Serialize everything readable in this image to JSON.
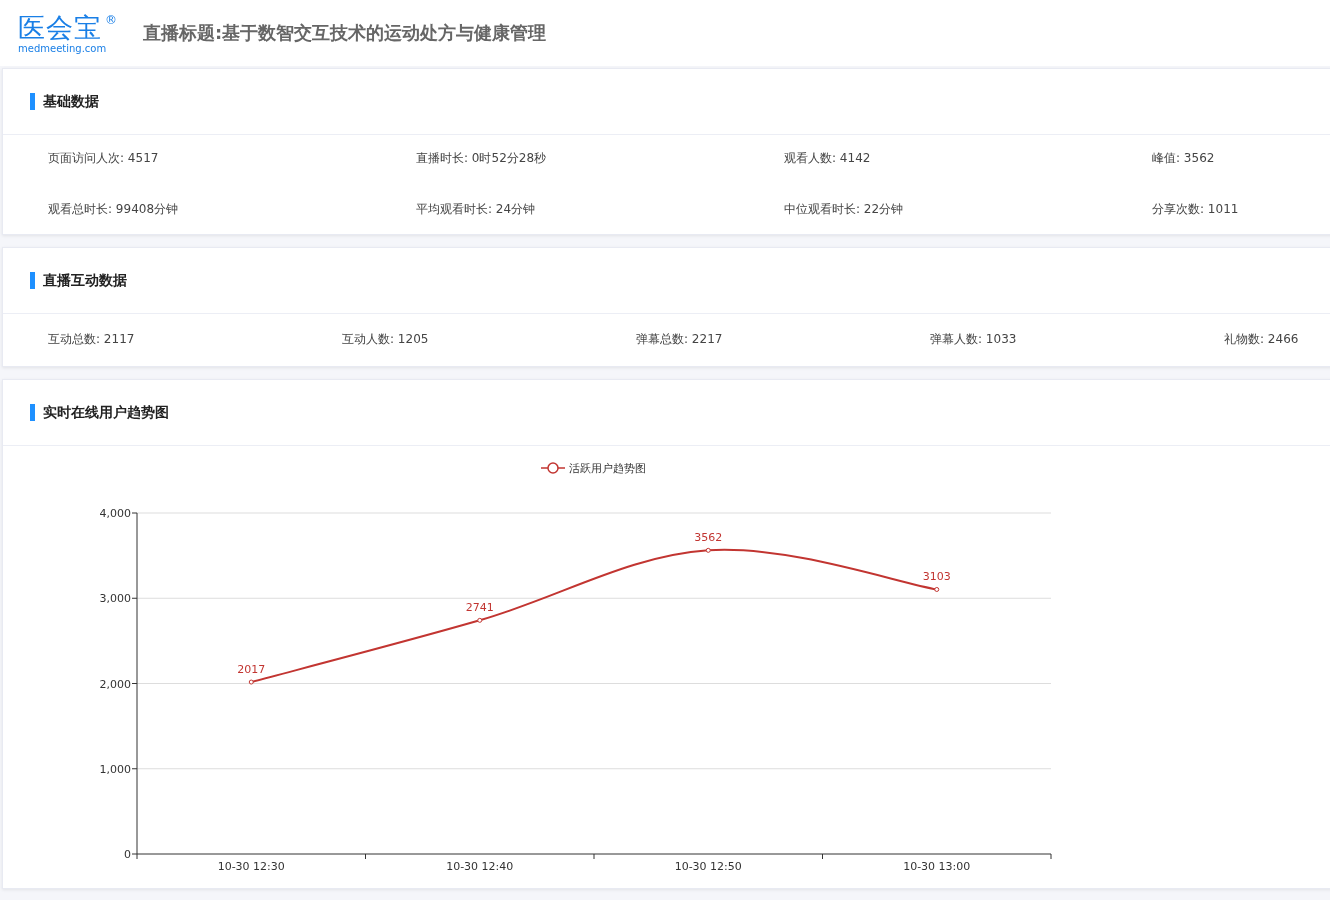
{
  "header": {
    "logo_text": "医会宝",
    "logo_mark": "®",
    "logo_domain": "medmeeting.com",
    "title": "直播标题:基于数智交互技术的运动处方与健康管理"
  },
  "basic": {
    "title": "基础数据",
    "items": [
      "页面访问人次: 4517",
      "直播时长: 0时52分28秒",
      "观看人数: 4142",
      "峰值: 3562",
      "观看总时长: 99408分钟",
      "平均观看时长: 24分钟",
      "中位观看时长: 22分钟",
      "分享次数: 1011"
    ]
  },
  "interaction": {
    "title": "直播互动数据",
    "items": [
      "互动总数: 2117",
      "互动人数: 1205",
      "弹幕总数: 2217",
      "弹幕人数: 1033",
      "礼物数: 2466"
    ]
  },
  "trend": {
    "title": "实时在线用户趋势图",
    "chart_data": {
      "type": "line",
      "categories": [
        "10-30 12:30",
        "10-30 12:40",
        "10-30 12:50",
        "10-30 13:00"
      ],
      "series": [
        {
          "name": "活跃用户趋势图",
          "color": "#c23531",
          "marker": "circle",
          "values": [
            2017,
            2741,
            3562,
            3103
          ]
        }
      ],
      "grid": true,
      "ylim": [
        0,
        4000
      ],
      "yticks": [
        {
          "value": 0,
          "label": "0"
        },
        {
          "value": 1000,
          "label": "1,000"
        },
        {
          "value": 2000,
          "label": "2,000"
        },
        {
          "value": 3000,
          "label": "3,000"
        },
        {
          "value": 4000,
          "label": "4,000"
        }
      ],
      "data_labels": true
    }
  }
}
